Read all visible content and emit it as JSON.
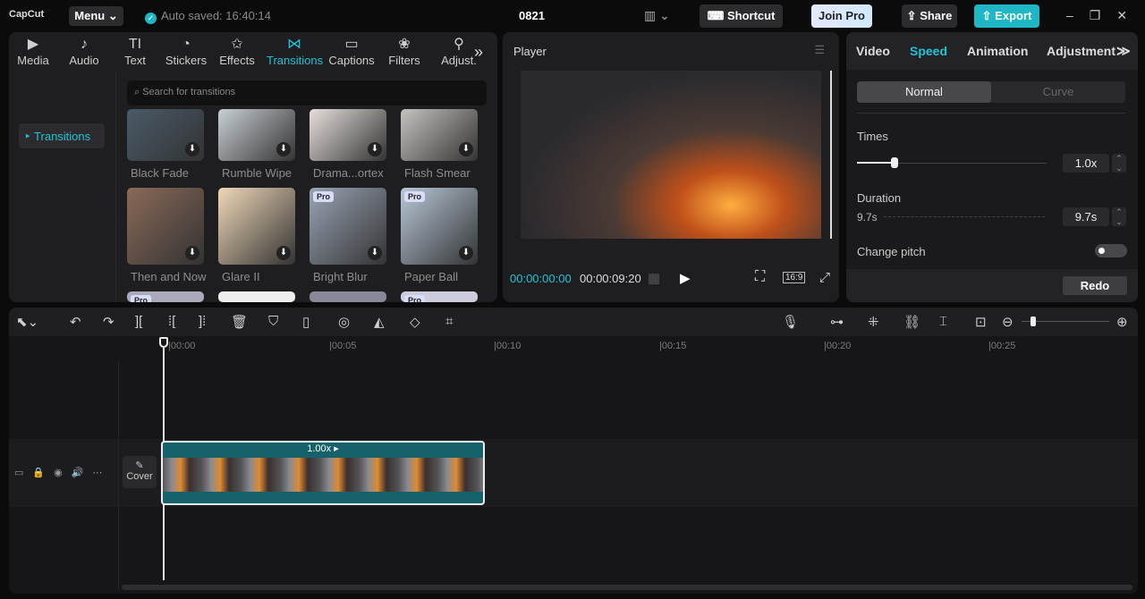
{
  "app": {
    "logo": "CapCut",
    "menu": "Menu",
    "auto_saved": "Auto saved: 16:40:14",
    "project": "0821",
    "shortcut": "Shortcut",
    "join_pro": "Join Pro",
    "share": "Share",
    "export": "Export"
  },
  "media_tabs": [
    {
      "label": "Media",
      "icon": "▶"
    },
    {
      "label": "Audio",
      "icon": "♪"
    },
    {
      "label": "Text",
      "icon": "TI"
    },
    {
      "label": "Stickers",
      "icon": "◔"
    },
    {
      "label": "Effects",
      "icon": "✩"
    },
    {
      "label": "Transitions",
      "icon": "⋈"
    },
    {
      "label": "Captions",
      "icon": "▭"
    },
    {
      "label": "Filters",
      "icon": "❀"
    },
    {
      "label": "Adjust.",
      "icon": "⚲"
    }
  ],
  "sidebar": {
    "item": "Transitions"
  },
  "search": {
    "placeholder": "Search for transitions"
  },
  "transitions": [
    {
      "name": "Black Fade",
      "pro": false,
      "color": "#4a5a68"
    },
    {
      "name": "Rumble Wipe",
      "pro": false,
      "color": "#c9cfd4"
    },
    {
      "name": "Drama...ortex",
      "pro": false,
      "color": "#e6e0dc"
    },
    {
      "name": "Flash Smear",
      "pro": false,
      "color": "#c6c2c0"
    },
    {
      "name": "Then and Now",
      "pro": false,
      "color": "#8a6a58"
    },
    {
      "name": "Glare II",
      "pro": false,
      "color": "#f0d8b8"
    },
    {
      "name": "Bright Blur",
      "pro": true,
      "color": "#9aa4b4"
    },
    {
      "name": "Paper Ball",
      "pro": true,
      "color": "#b8c8d8"
    }
  ],
  "pro_label": "Pro",
  "player": {
    "title": "Player",
    "current": "00:00:00:00",
    "total": "00:00:09:20",
    "ratio": "16:9"
  },
  "right_panel": {
    "tabs": [
      "Video",
      "Speed",
      "Animation",
      "Adjustment"
    ],
    "active_tab": "Speed",
    "modes": [
      "Normal",
      "Curve"
    ],
    "times_label": "Times",
    "times_value": "1.0x",
    "times_fraction": 0.2,
    "duration_label": "Duration",
    "duration_start": "9.7s",
    "duration_value": "9.7s",
    "change_pitch": "Change pitch",
    "change_pitch_on": false,
    "redo": "Redo"
  },
  "timeline": {
    "ticks": [
      "00:00",
      "00:05",
      "00:10",
      "00:15",
      "00:20",
      "00:25"
    ],
    "clip_speed": "1.00x",
    "cover": "Cover"
  }
}
